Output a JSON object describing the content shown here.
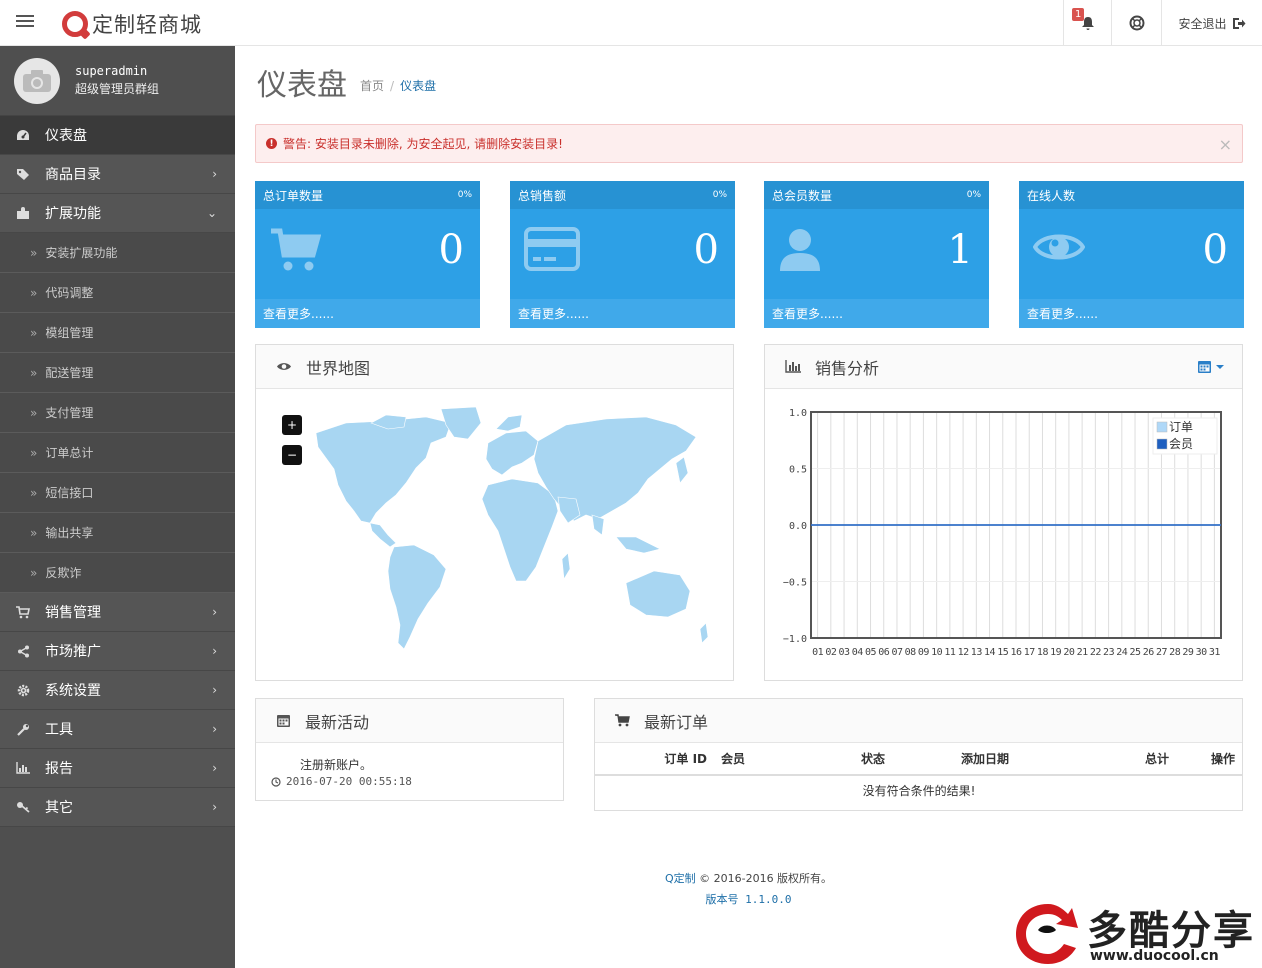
{
  "app": {
    "logo_text": "定制轻商城"
  },
  "header": {
    "notification_count": "1",
    "logout_label": "安全退出"
  },
  "profile": {
    "name": "superadmin",
    "group": "超级管理员群组"
  },
  "sidebar": {
    "items": [
      {
        "label": "仪表盘",
        "icon": "dashboard-icon",
        "active": true
      },
      {
        "label": "商品目录",
        "icon": "tags-icon"
      },
      {
        "label": "扩展功能",
        "icon": "puzzle-icon",
        "expanded": true
      },
      {
        "label": "销售管理",
        "icon": "cart-icon"
      },
      {
        "label": "市场推广",
        "icon": "share-icon"
      },
      {
        "label": "系统设置",
        "icon": "gear-icon"
      },
      {
        "label": "工具",
        "icon": "wrench-icon"
      },
      {
        "label": "报告",
        "icon": "bar-chart-icon"
      },
      {
        "label": "其它",
        "icon": "key-icon"
      }
    ],
    "sub_items": [
      "安装扩展功能",
      "代码调整",
      "模组管理",
      "配送管理",
      "支付管理",
      "订单总计",
      "短信接口",
      "输出共享",
      "反欺诈"
    ]
  },
  "page": {
    "title": "仪表盘",
    "breadcrumb_home": "首页",
    "breadcrumb_sep": "/",
    "breadcrumb_current": "仪表盘"
  },
  "alert": {
    "text": "警告: 安装目录未删除, 为安全起见, 请删除安装目录!",
    "close": "×"
  },
  "tiles": [
    {
      "title": "总订单数量",
      "percent": "0%",
      "value": "0",
      "more": "查看更多......",
      "icon": "cart-icon"
    },
    {
      "title": "总销售额",
      "percent": "0%",
      "value": "0",
      "more": "查看更多......",
      "icon": "credit-card-icon"
    },
    {
      "title": "总会员数量",
      "percent": "0%",
      "value": "1",
      "more": "查看更多......",
      "icon": "user-icon"
    },
    {
      "title": "在线人数",
      "percent": "",
      "value": "0",
      "more": "查看更多......",
      "icon": "eye-icon"
    }
  ],
  "world_map": {
    "title": "世界地图",
    "zoom_in": "+",
    "zoom_out": "−"
  },
  "sales": {
    "title": "销售分析"
  },
  "chart_data": {
    "type": "line",
    "x": [
      "01",
      "02",
      "03",
      "04",
      "05",
      "06",
      "07",
      "08",
      "09",
      "10",
      "11",
      "12",
      "13",
      "14",
      "15",
      "16",
      "17",
      "18",
      "19",
      "20",
      "21",
      "22",
      "23",
      "24",
      "25",
      "26",
      "27",
      "28",
      "29",
      "30",
      "31"
    ],
    "series": [
      {
        "name": "订单",
        "values": [
          0,
          0,
          0,
          0,
          0,
          0,
          0,
          0,
          0,
          0,
          0,
          0,
          0,
          0,
          0,
          0,
          0,
          0,
          0,
          0,
          0,
          0,
          0,
          0,
          0,
          0,
          0,
          0,
          0,
          0,
          0
        ]
      },
      {
        "name": "会员",
        "values": [
          0,
          0,
          0,
          0,
          0,
          0,
          0,
          0,
          0,
          0,
          0,
          0,
          0,
          0,
          0,
          0,
          0,
          0,
          0,
          0,
          0,
          0,
          0,
          0,
          0,
          0,
          0,
          0,
          0,
          0,
          0
        ]
      }
    ],
    "yticks": [
      "1.0",
      "0.5",
      "0.0",
      "−0.5",
      "−1.0"
    ],
    "ylim": [
      -1,
      1
    ],
    "grid": true,
    "legend": "top-right",
    "colors": {
      "orders": "#afd8f8",
      "members": "#1e5fc0"
    }
  },
  "activity": {
    "title": "最新活动",
    "entry_text": "注册新账户。",
    "entry_time": "2016-07-20 00:55:18"
  },
  "orders": {
    "title": "最新订单",
    "columns": [
      "订单 ID",
      "会员",
      "状态",
      "添加日期",
      "总计",
      "操作"
    ],
    "empty": "没有符合条件的结果!"
  },
  "footer": {
    "brand": "Q定制",
    "copyright": "© 2016-2016 版权所有。",
    "version": "版本号 1.1.0.0"
  },
  "watermark": {
    "text": "多酷分享",
    "url": "www.duocool.cn"
  }
}
